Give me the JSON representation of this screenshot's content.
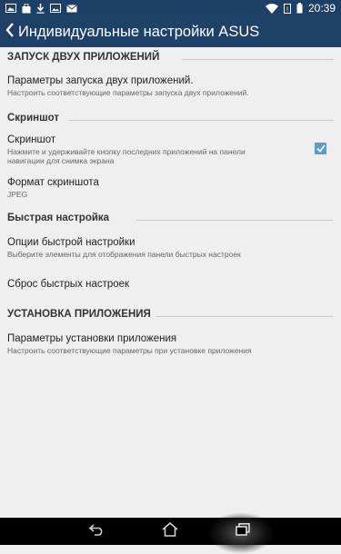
{
  "status_bar": {
    "time": "20:39",
    "left_icons": [
      "photo-icon",
      "bag-icon",
      "download-icon",
      "image-icon",
      "email-icon"
    ],
    "right_icons": [
      "wifi-icon",
      "notification-icon",
      "battery-icon"
    ]
  },
  "app_bar": {
    "title": "Индивидуальные настройки ASUS"
  },
  "sections": {
    "dual_apps": {
      "header": "ЗАПУСК ДВУХ ПРИЛОЖЕНИЙ",
      "item_title": "Параметры запуска двух приложений.",
      "item_sub": "Настроить соответствующие параметры запуска двух приложений."
    },
    "screenshot": {
      "header": "Скриншот",
      "toggle_title": "Скриншот",
      "toggle_sub_1": "Нажмите и удерживайте кнопку последних приложений на панели",
      "toggle_sub_2": "навигации для снимка экрана",
      "toggle_checked": true,
      "format_title": "Формат скриншота",
      "format_value": "JPEG"
    },
    "quick": {
      "header": "Быстрая настройка",
      "options_title": "Опции быстрой настройки",
      "options_sub": "Выберите элементы для отображения панели быстрых настроек",
      "reset_title": "Сброс быстрых настроек"
    },
    "install": {
      "header": "УСТАНОВКА ПРИЛОЖЕНИЯ",
      "item_title": "Параметры установки приложения",
      "item_sub": "Настроить соответствующие параметры при установке приложения"
    }
  },
  "nav_bar": {
    "buttons": [
      "back-icon",
      "home-icon",
      "recent-apps-icon"
    ]
  },
  "colors": {
    "app_bar": "#1f4168",
    "status_bar": "#1e3f66",
    "background": "#efefef",
    "checkbox": "#5b9bc9"
  }
}
